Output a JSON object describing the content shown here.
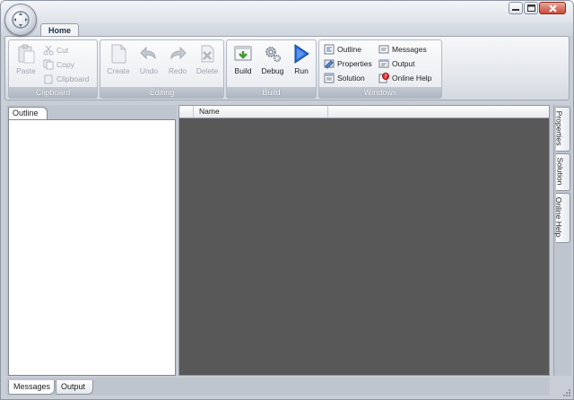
{
  "window": {
    "controls": {
      "minimize": "minimize",
      "maximize": "maximize",
      "close": "close"
    }
  },
  "ribbon": {
    "tab": "Home",
    "groups": {
      "clipboard": {
        "title": "Clipboard",
        "paste": "Paste",
        "cut": "Cut",
        "copy": "Copy",
        "clipboard": "Clipboard"
      },
      "editing": {
        "title": "Editing",
        "create": "Create",
        "undo": "Undo",
        "redo": "Redo",
        "delete": "Delete"
      },
      "build": {
        "title": "Build",
        "build": "Build",
        "debug": "Debug",
        "run": "Run"
      },
      "windows": {
        "title": "Windows",
        "outline": "Outline",
        "properties": "Properties",
        "solution": "Solution",
        "messages": "Messages",
        "output": "Output",
        "online_help": "Online Help"
      }
    }
  },
  "panes": {
    "left_tab": "Outline",
    "grid_columns": [
      "",
      "Name"
    ],
    "right_tabs": [
      "Properties",
      "Solution",
      "Online Help"
    ],
    "bottom_tabs": [
      "Messages",
      "Output"
    ]
  },
  "icons": {
    "app_menu": "app-orb-icon",
    "paste": "paste-icon",
    "cut": "scissors-icon",
    "copy": "copy-icon",
    "clipboard": "clipboard-icon",
    "create": "new-document-icon",
    "undo": "undo-icon",
    "redo": "redo-icon",
    "delete": "delete-icon",
    "build": "build-icon",
    "debug": "gear-icon",
    "run": "play-icon",
    "outline": "outline-icon",
    "properties": "properties-icon",
    "solution": "solution-icon",
    "messages": "messages-icon",
    "output": "output-icon",
    "online_help": "help-icon"
  },
  "colors": {
    "run_accent": "#2a6fd6",
    "build_accent": "#3f9b2f",
    "close_button": "#c9493a",
    "grid_background": "#585858"
  }
}
